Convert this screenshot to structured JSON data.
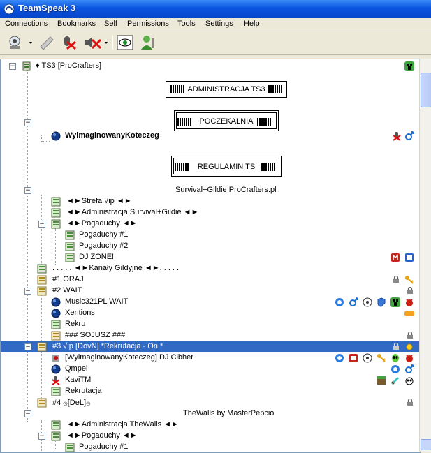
{
  "window": {
    "title": "TeamSpeak 3"
  },
  "menu": [
    "Connections",
    "Bookmarks",
    "Self",
    "Permissions",
    "Tools",
    "Settings",
    "Help"
  ],
  "toolbar": {
    "buttons": [
      "connect-icon",
      "disconnect-icon",
      "mute-microphone-icon",
      "mute-speakers-icon",
      "view-icon",
      "identity-icon"
    ]
  },
  "tree": {
    "server": "♦ TS3 [ProCrafters]",
    "admin_box": "ADMINISTRACJA TS3",
    "waiting_box": "POCZEKALNIA",
    "waiting_user": "WyimaginowanyKoteczeg",
    "rules_box": "REGULAMIN TS",
    "survival_header": "Survival+Gildie ProCrafters.pl",
    "strefa": "◄►Strefa √ip ◄►",
    "admin_survival": "◄►Administracja Survival+Gildie ◄►",
    "pogaduchy": "◄►Pogaduchy ◄►",
    "pogaduchy1": "Pogaduchy #1",
    "pogaduchy2": "Pogaduchy #2",
    "djzone": "DJ ZONE!",
    "kanaly": ". . . . . ◄►Kanały Gildyjne ◄►. . . . .",
    "oraj": "#1 ORAJ",
    "wait": "#2 WAIT",
    "music": "Music321PL WAIT",
    "xentions": "Xentions",
    "rekru": "Rekru",
    "sojusz": "### SOJUSZ ###",
    "dovn": "#3 √ip  [DovN]  *Rekrutacja - On *",
    "cibher": "[WyimaginowanyKoteczeg] DJ Cibher",
    "qmpel": "Qmpel",
    "kavi": "KaviTM",
    "rekrutacja": "Rekrutacja",
    "del": "#4 ۞[DeL]۞",
    "walls_header": "TheWalls by MasterPepcio",
    "admin_walls": "◄►Administracja TheWalls ◄►",
    "pogaduchy_walls": "◄►Pogaduchy ◄►",
    "pogaduchy_walls1": "Pogaduchy #1"
  },
  "colors": {
    "selection": "#316ac5",
    "title_bar": "#0a54e0"
  }
}
